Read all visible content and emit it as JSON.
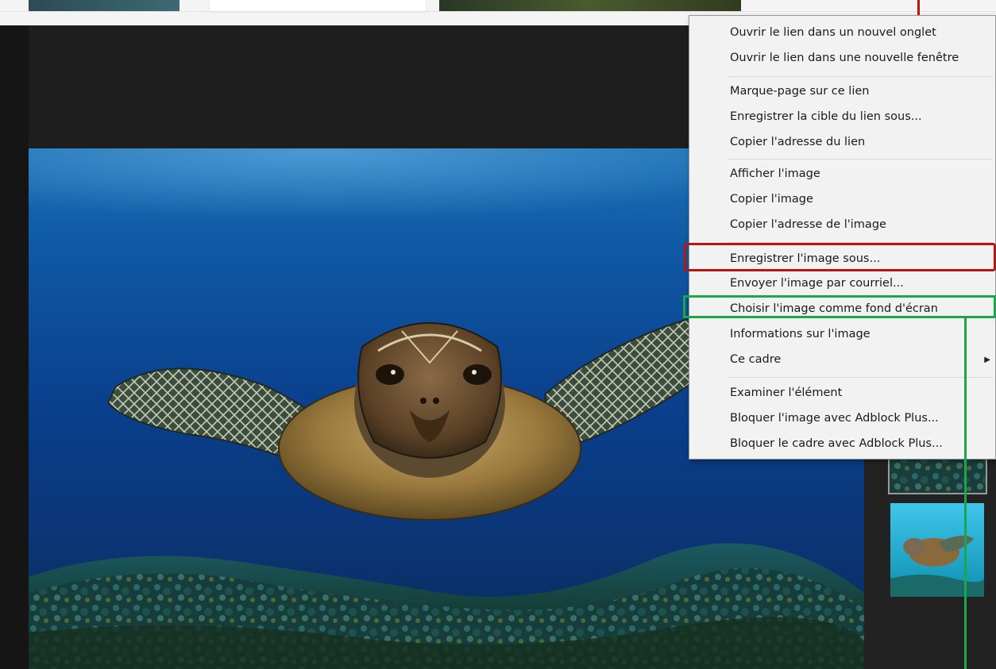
{
  "context_menu": {
    "items": [
      {
        "label": "Ouvrir le lien dans un nouvel onglet"
      },
      {
        "label": "Ouvrir le lien dans une nouvelle fenêtre"
      },
      {
        "label": "Marque-page sur ce lien"
      },
      {
        "label": "Enregistrer la cible du lien sous..."
      },
      {
        "label": "Copier l'adresse du lien"
      },
      {
        "label": "Afficher l'image"
      },
      {
        "label": "Copier l'image"
      },
      {
        "label": "Copier l'adresse de l'image"
      },
      {
        "label": "Enregistrer l'image sous..."
      },
      {
        "label": "Envoyer l'image par courriel..."
      },
      {
        "label": "Choisir l'image comme fond d'écran"
      },
      {
        "label": "Informations sur l'image"
      },
      {
        "label": "Ce cadre",
        "submenu": true
      },
      {
        "label": "Examiner l'élément"
      },
      {
        "label": "Bloquer l'image avec Adblock Plus..."
      },
      {
        "label": "Bloquer le cadre avec Adblock Plus..."
      }
    ]
  },
  "annotations": {
    "highlight_color": "#b81515",
    "secondary_color": "#1aa64a"
  },
  "icons": {
    "submenu_arrow": "chevron-right-icon"
  }
}
